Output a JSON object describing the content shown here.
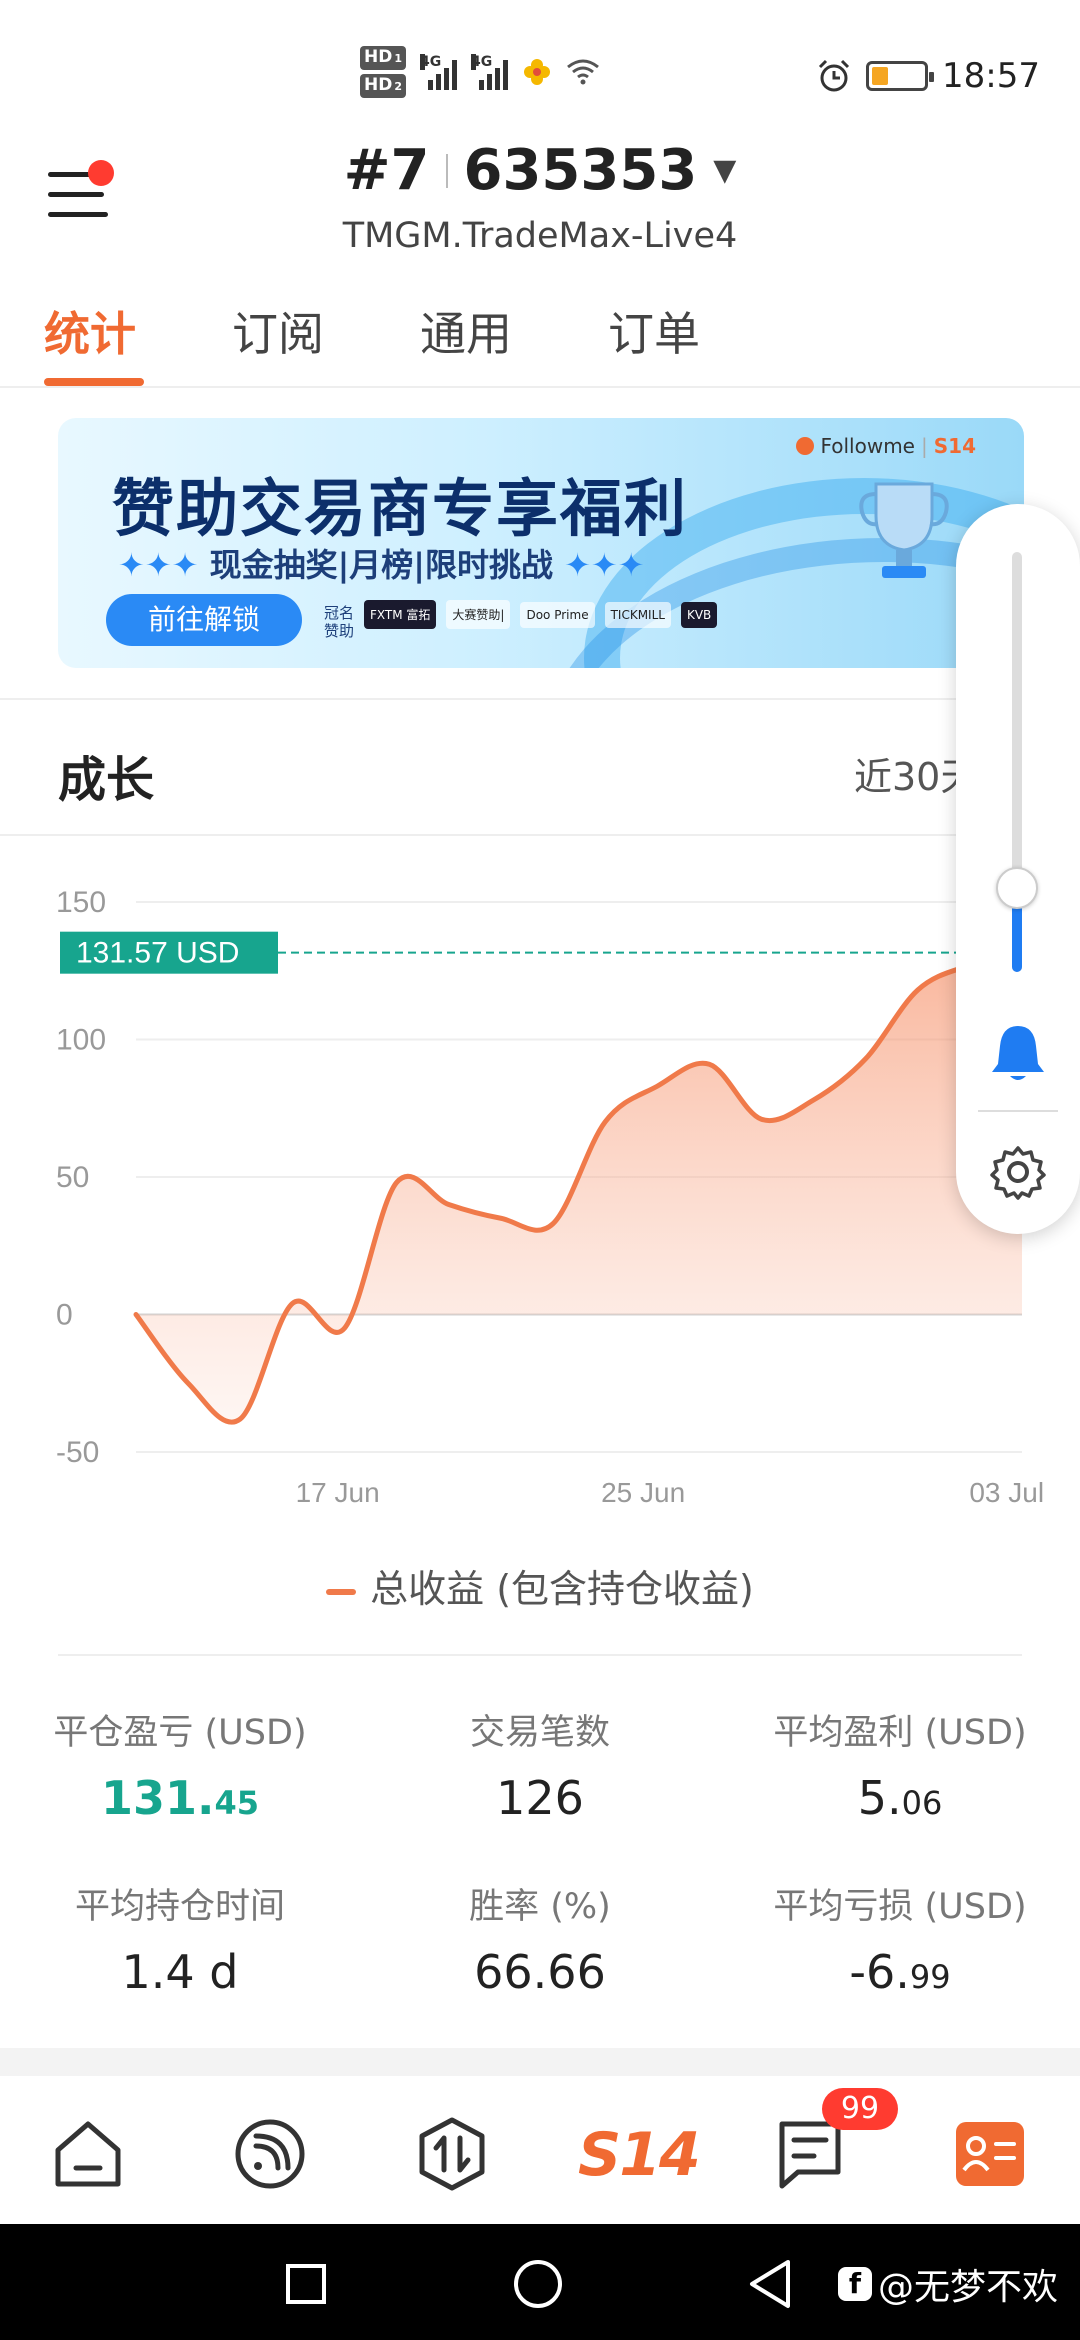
{
  "status_bar": {
    "hd1": "HD",
    "hd1_index": "1",
    "hd2": "HD",
    "hd2_index": "2",
    "net1": "4G",
    "net2": "4G",
    "time": "18:57",
    "battery_level": 0.3
  },
  "header": {
    "account_prefix": "#7",
    "account_number": "635353",
    "server": "TMGM.TradeMax-Live4"
  },
  "tabs": [
    {
      "label": "统计",
      "active": true
    },
    {
      "label": "订阅",
      "active": false
    },
    {
      "label": "通用",
      "active": false
    },
    {
      "label": "订单",
      "active": false
    }
  ],
  "banner": {
    "title": "赞助交易商专享福利",
    "subtitle": "现金抽奖|月榜|限时挑战",
    "button": "前往解锁",
    "sponsor_label": "冠名赞助",
    "sponsors": [
      "FXTM 富拓",
      "大赛赞助|",
      "Doo Prime",
      "TICKMILL",
      "KVB"
    ],
    "brand": "Followme",
    "brand_s14": "S14"
  },
  "growth": {
    "title": "成长",
    "range": "近30天"
  },
  "chart_data": {
    "type": "area",
    "x_ticks": [
      "17 Jun",
      "25 Jun",
      "03 Jul"
    ],
    "ylim": [
      -50,
      150
    ],
    "y_ticks": [
      -50,
      0,
      50,
      100,
      150
    ],
    "current_value_label": "131.57 USD",
    "current_value": 131.57,
    "series": [
      {
        "name": "总收益 (包含持仓收益)",
        "x": [
          0,
          1,
          2,
          3,
          4,
          5,
          6,
          7,
          8,
          9,
          10,
          11,
          12,
          13,
          14,
          15,
          16,
          17,
          18,
          19,
          20,
          21,
          22,
          23,
          24,
          25,
          26,
          27,
          28,
          29
        ],
        "values": [
          0,
          -25,
          -38,
          4,
          -5,
          48,
          40,
          35,
          33,
          70,
          83,
          91,
          71,
          78,
          93,
          118,
          127,
          131.57,
          null,
          null,
          null,
          null,
          null,
          null,
          null,
          null,
          null,
          null,
          null,
          null
        ]
      }
    ],
    "grid": true,
    "legend": "bottom"
  },
  "stats": [
    {
      "label": "平仓盈亏 (USD)",
      "int": "131.",
      "dec": "45",
      "green": true
    },
    {
      "label": "交易笔数",
      "int": "126",
      "dec": "",
      "green": false
    },
    {
      "label": "平均盈利 (USD)",
      "int": "5.",
      "dec": "06",
      "green": false
    },
    {
      "label": "平均持仓时间",
      "int": "1.4 d",
      "dec": "",
      "green": false
    },
    {
      "label": "胜率 (%)",
      "int": "66.66",
      "dec": "",
      "green": false
    },
    {
      "label": "平均亏损 (USD)",
      "int": "-6.",
      "dec": "99",
      "green": false
    }
  ],
  "bottom_nav": {
    "items": [
      "home-icon",
      "feed-icon",
      "trade-icon",
      "S14",
      "message-icon",
      "profile-card-icon"
    ],
    "s14_label": "S14",
    "badge": "99"
  },
  "watermark": "@无梦不欢",
  "float_panel": {
    "slider_level": 0.2
  },
  "colors": {
    "accent": "#f06a32",
    "green": "#17a58e",
    "chart_line": "#f07a4a",
    "blue": "#1f7cf2"
  }
}
